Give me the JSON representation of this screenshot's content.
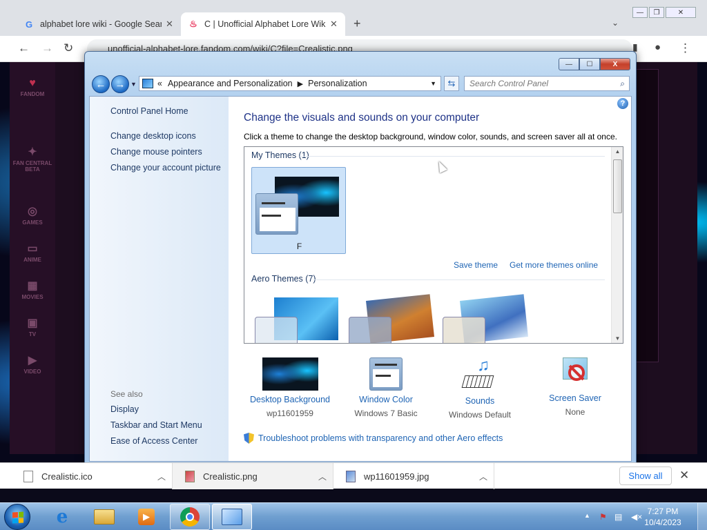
{
  "browser": {
    "tabs": [
      {
        "title": "alphabet lore wiki - Google Search",
        "favicon": "google-icon",
        "active": false
      },
      {
        "title": "C | Unofficial Alphabet Lore Wiki",
        "favicon": "fandom-icon",
        "active": true
      }
    ],
    "url": "unofficial-alphabet-lore.fandom.com/wiki/C?file=Crealistic.png",
    "fandom_nav": [
      "FANDOM",
      "FAN CENTRAL BETA",
      "GAMES",
      "ANIME",
      "MOVIES",
      "TV",
      "VIDEO"
    ]
  },
  "window": {
    "minimize": "—",
    "maximize": "☐",
    "close": "X"
  },
  "navbar": {
    "back": "←",
    "forward": "→",
    "breadcrumbs": [
      "Appearance and Personalization",
      "Personalization"
    ],
    "crumb_prefix": "«",
    "search_placeholder": "Search Control Panel"
  },
  "sidebar": {
    "home": "Control Panel Home",
    "links": [
      "Change desktop icons",
      "Change mouse pointers",
      "Change your account picture"
    ],
    "see_also_label": "See also",
    "see_also": [
      "Display",
      "Taskbar and Start Menu",
      "Ease of Access Center"
    ]
  },
  "main": {
    "title": "Change the visuals and sounds on your computer",
    "description": "Click a theme to change the desktop background, window color, sounds, and screen saver all at once.",
    "my_themes_header": "My Themes (1)",
    "my_theme_name": "F",
    "save_theme": "Save theme",
    "get_more_themes": "Get more themes online",
    "aero_themes_header": "Aero Themes (7)",
    "help": "?"
  },
  "bottom": [
    {
      "label": "Desktop Background",
      "value": "wp11601959",
      "icon": "desktop-background-icon"
    },
    {
      "label": "Window Color",
      "value": "Windows 7 Basic",
      "icon": "window-color-icon"
    },
    {
      "label": "Sounds",
      "value": "Windows Default",
      "icon": "sounds-icon"
    },
    {
      "label": "Screen Saver",
      "value": "None",
      "icon": "screen-saver-icon"
    }
  ],
  "troubleshoot": "Troubleshoot problems with transparency and other Aero effects",
  "downloads": {
    "items": [
      "Crealistic.ico",
      "Crealistic.png",
      "wp11601959.jpg"
    ],
    "show_all": "Show all"
  },
  "taskbar": {
    "apps": [
      "internet-explorer-icon",
      "windows-explorer-icon",
      "media-player-icon",
      "chrome-icon",
      "control-panel-icon"
    ],
    "time": "7:27 PM",
    "date": "10/4/2023"
  }
}
